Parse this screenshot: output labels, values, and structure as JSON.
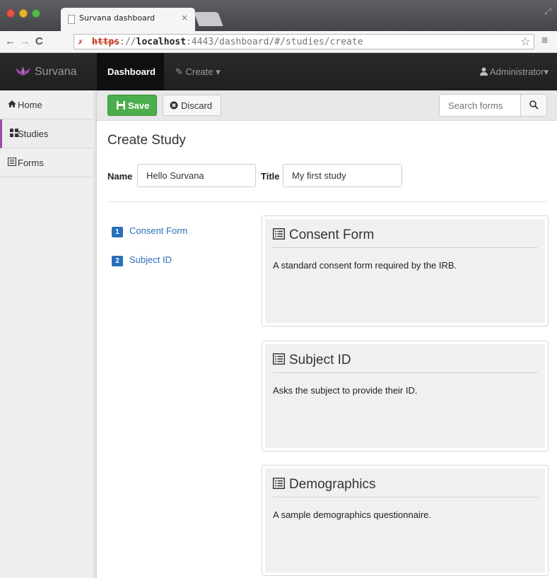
{
  "browser": {
    "tab_title": "Survana dashboard",
    "tab_close": "×",
    "url_scheme": "https",
    "url_sep": "://",
    "url_host": "localhost",
    "url_rest": ":4443/dashboard/#/studies/create"
  },
  "navbar": {
    "brand": "Survana",
    "brand_color": "#9d4aa8",
    "active_item": "Dashboard",
    "create_menu": "Create",
    "user_menu": "Administrator"
  },
  "sidebar": {
    "items": [
      {
        "label": "Home",
        "icon": "home-icon"
      },
      {
        "label": "Studies",
        "icon": "grid-icon",
        "active": true
      },
      {
        "label": "Forms",
        "icon": "list-icon"
      }
    ]
  },
  "actions": {
    "save_label": "Save",
    "discard_label": "Discard",
    "search_placeholder": "Search forms",
    "save_color": "#4cae4c"
  },
  "page": {
    "title": "Create Study",
    "name_label": "Name",
    "name_value": "Hello Survana",
    "title_label": "Title",
    "title_value": "My first study"
  },
  "steps": [
    {
      "num": "1",
      "label": "Consent Form"
    },
    {
      "num": "2",
      "label": "Subject ID"
    }
  ],
  "forms": [
    {
      "title": "Consent Form",
      "description": "A standard consent form required by the IRB."
    },
    {
      "title": "Subject ID",
      "description": "Asks the subject to provide their ID."
    },
    {
      "title": "Demographics",
      "description": "A sample demographics questionnaire."
    }
  ]
}
